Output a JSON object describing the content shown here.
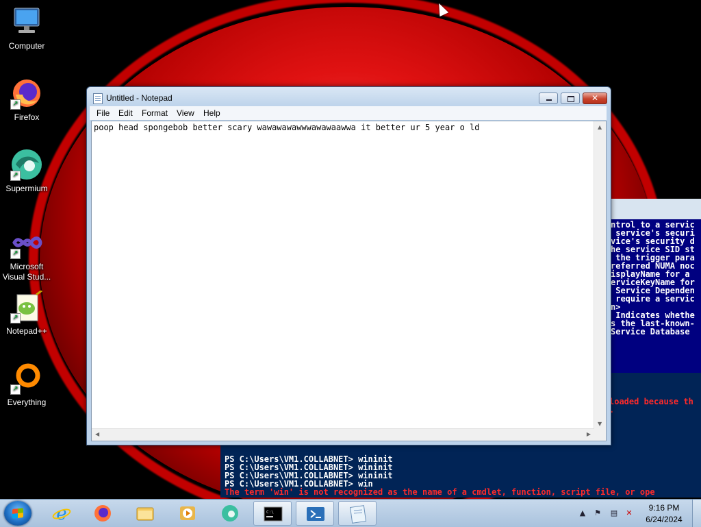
{
  "desktop": {
    "icons": [
      {
        "label": "Computer",
        "icon": "computer-icon"
      },
      {
        "label": "Firefox",
        "icon": "firefox-icon"
      },
      {
        "label": "Supermium",
        "icon": "supermium-icon"
      },
      {
        "label": "Microsoft Visual Stud...",
        "icon": "visual-studio-icon"
      },
      {
        "label": "Notepad++",
        "icon": "notepadpp-icon"
      },
      {
        "label": "Everything",
        "icon": "everything-icon"
      }
    ]
  },
  "notepad": {
    "title": "Untitled - Notepad",
    "menu": [
      "File",
      "Edit",
      "Format",
      "View",
      "Help"
    ],
    "content": "poop head spongebob better scary wawawawawwwawawaawwa it better ur 5 year o ld",
    "close_glyph": "✕"
  },
  "powershell": {
    "right_lines": [
      "ntrol to a servic",
      " service's securi",
      "vice's security d",
      "he service SID st",
      "",
      " the trigger para",
      "referred NUMA noc",
      "isplayName for a",
      "erviceKeyName for",
      " Service Dependen",
      "",
      " require a servic",
      "n>",
      " Indicates whethe",
      "s the last-known-",
      "Service Database"
    ],
    "red_right_lines": [
      "loaded because th",
      "."
    ],
    "bottom_lines": [
      "PS C:\\Users\\VM1.COLLABNET> wininit",
      "PS C:\\Users\\VM1.COLLABNET> wininit",
      "PS C:\\Users\\VM1.COLLABNET> wininit",
      "PS C:\\Users\\VM1.COLLABNET> win"
    ],
    "error_line": "The term 'win' is not recognized as the name of a cmdlet, function, script file, or ope"
  },
  "taskbar": {
    "apps": [
      {
        "name": "internet-explorer",
        "icon": "ie-icon",
        "active": false
      },
      {
        "name": "firefox",
        "icon": "firefox-icon",
        "active": false
      },
      {
        "name": "file-explorer",
        "icon": "folder-icon",
        "active": false
      },
      {
        "name": "media-player",
        "icon": "media-player-icon",
        "active": false
      },
      {
        "name": "supermium",
        "icon": "supermium-icon",
        "active": false
      },
      {
        "name": "command-prompt",
        "icon": "cmd-icon",
        "active": true
      },
      {
        "name": "powershell",
        "icon": "powershell-icon",
        "active": true
      },
      {
        "name": "notepad",
        "icon": "notepad-icon",
        "active": true
      }
    ],
    "clock": {
      "time": "9:16 PM",
      "date": "6/24/2024"
    },
    "tray_icons": [
      "show-hidden-icons-chevron",
      "action-center-flag-icon",
      "network-icon",
      "volume-muted-icon"
    ]
  },
  "colors": {
    "ps_background": "#012456",
    "ps_error": "#ff2a2a",
    "wallpaper_red": "#e01212"
  }
}
